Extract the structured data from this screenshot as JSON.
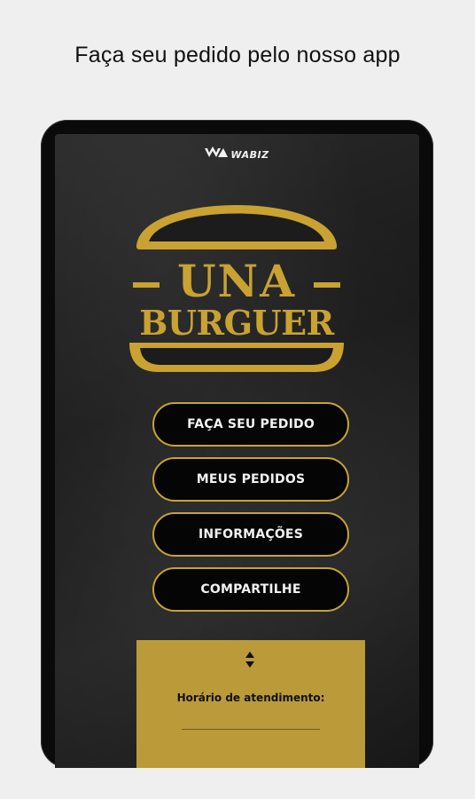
{
  "headline": "Faça seu pedido pelo nosso app",
  "brand": {
    "name": "WABIZ",
    "icon": "wabiz-logo-icon"
  },
  "logo": {
    "line1": "UNA",
    "line2": "BURGUER",
    "icon": "burger-bun-icon",
    "color": "#c9a232"
  },
  "menu": {
    "items": [
      {
        "label": "FAÇA SEU PEDIDO"
      },
      {
        "label": "MEUS PEDIDOS"
      },
      {
        "label": "INFORMAÇÕES"
      },
      {
        "label": "COMPARTILHE"
      }
    ]
  },
  "info_panel": {
    "toggle_icon": "sort-arrows-icon",
    "hours_label": "Horário de atendimento:",
    "color": "#bb9a3a"
  }
}
